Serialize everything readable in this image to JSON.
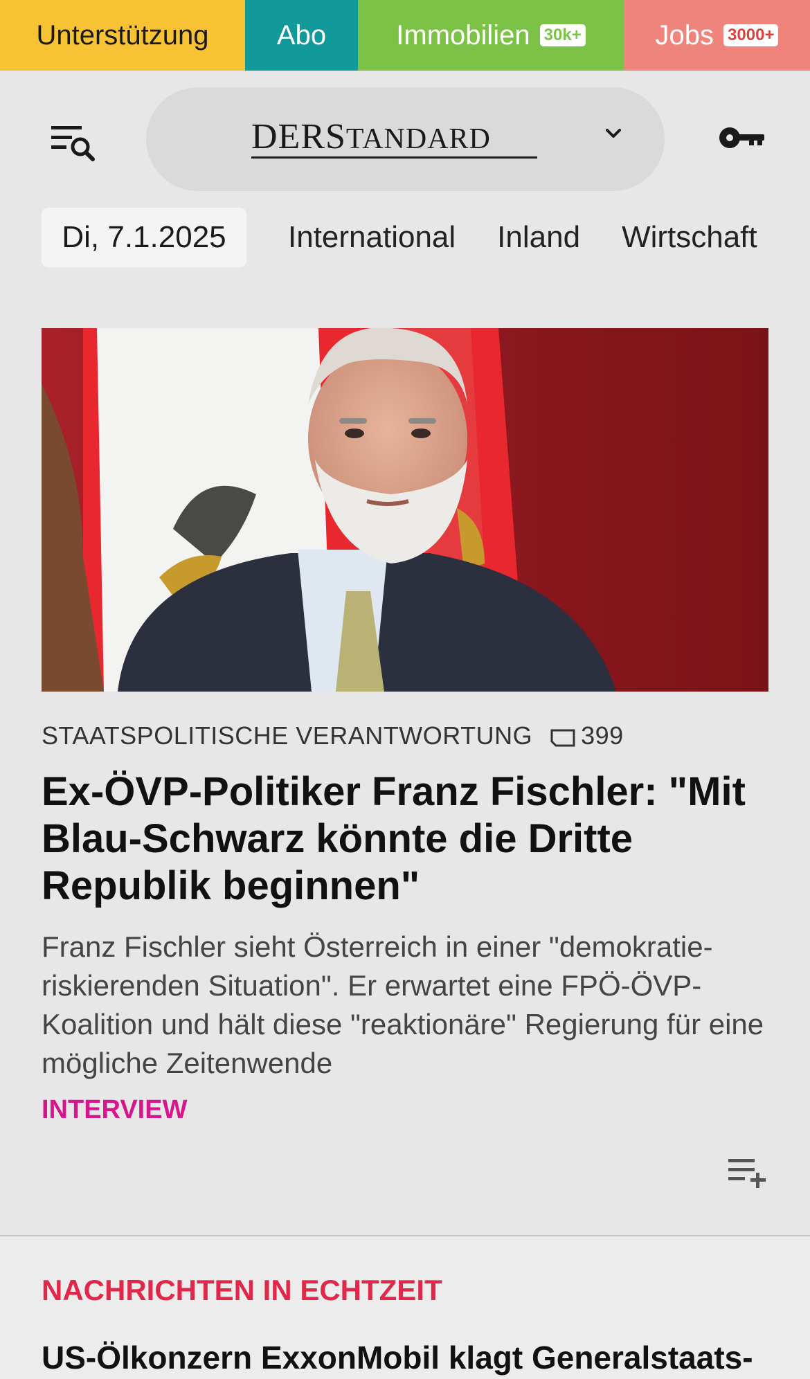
{
  "topbar": [
    {
      "label": "Unterstützung",
      "badge": ""
    },
    {
      "label": "Abo",
      "badge": ""
    },
    {
      "label": "Immobilien",
      "badge": "30k+"
    },
    {
      "label": "Jobs",
      "badge": "3000+"
    }
  ],
  "header": {
    "logo_der": "DER",
    "logo_s": "S",
    "logo_tandard": "TANDARD",
    "menu_icon": "menu-search-icon",
    "dropdown_icon": "chevron-down-icon",
    "login_icon": "key-icon"
  },
  "nav": {
    "date": "Di, 7.1.2025",
    "links": [
      "International",
      "Inland",
      "Wirtschaft"
    ]
  },
  "article": {
    "image_alt": "Franz Fischler vor österreichischer Flagge",
    "kicker": "STAATSPOLITISCHE VERANTWORTUNG",
    "comment_count": "399",
    "headline": "Ex-ÖVP-Politiker Franz Fischler: \"Mit Blau-Schwarz könnte die Dritte Republik beginnen\"",
    "teaser": "Franz Fischler sieht Österreich in einer \"demokratie-riskierenden Situation\". Er erwartet eine FPÖ-ÖVP-Koalition und hält diese \"reaktionäre\" Regierung für eine mögliche Zeitenwende",
    "tag": "INTERVIEW"
  },
  "live": {
    "title": "NACHRICHTEN IN ECHTZEIT",
    "first_headline": "US-Ölkonzern ExxonMobil klagt Generalstaats-"
  },
  "colors": {
    "support": "#f7c233",
    "abo": "#12999a",
    "immobilien": "#7cc246",
    "jobs": "#ee847b",
    "tag": "#d6168c",
    "live": "#e0284a"
  }
}
